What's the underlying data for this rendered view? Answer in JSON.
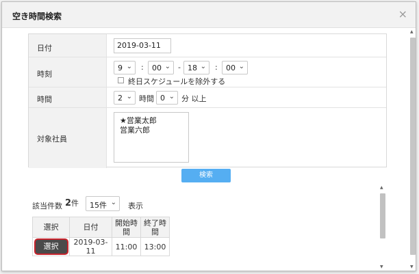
{
  "dialog": {
    "title": "空き時間検索",
    "close": "×"
  },
  "form": {
    "date_label": "日付",
    "date_value": "2019-03-11",
    "time_label": "時刻",
    "start_hour": "9",
    "start_min": "00",
    "end_hour": "18",
    "end_min": "00",
    "colon": ":",
    "dash": "-",
    "exclude_allday": "終日スケジュールを除外する",
    "duration_label": "時間",
    "dur_hours": "2",
    "hours_unit": "時間",
    "dur_minutes": "0",
    "minutes_unit": "分 以上",
    "target_label": "対象社員",
    "employees": [
      "★営業太郎",
      "営業六郎"
    ]
  },
  "search_button": "検索",
  "results": {
    "count_label": "該当件数",
    "count": "2",
    "count_unit": "件",
    "per_page": "15件",
    "show_label": "表示",
    "headers": [
      "選択",
      "日付",
      "開始時\n間",
      "終了時\n間"
    ],
    "rows": [
      {
        "select": "選択",
        "date": "2019-03-11",
        "start": "11:00",
        "end": "13:00"
      }
    ]
  },
  "icons": {
    "chevron": "chevron-down-icon",
    "close": "close-icon"
  }
}
